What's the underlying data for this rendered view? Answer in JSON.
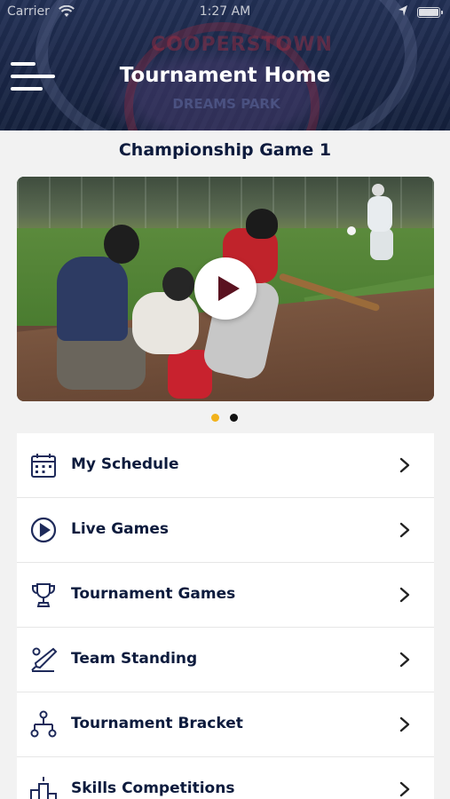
{
  "status_bar": {
    "carrier": "Carrier",
    "time": "1:27 AM",
    "icons": [
      "wifi-icon",
      "location-arrow-icon",
      "battery-icon"
    ]
  },
  "header": {
    "title": "Tournament Home",
    "background_logo_text": [
      "COOPERSTOWN",
      "DREAMS PARK"
    ],
    "menu_icon": "hamburger-menu-icon"
  },
  "featured": {
    "title": "Championship Game 1",
    "media": "baseball game video thumbnail",
    "play_icon": "play-icon",
    "pager": {
      "count": 2,
      "active_index": 0,
      "active_color": "#f2b21b",
      "inactive_color": "#111111"
    }
  },
  "menu": {
    "items": [
      {
        "label": "My Schedule",
        "icon": "calendar-icon"
      },
      {
        "label": "Live Games",
        "icon": "play-circle-icon"
      },
      {
        "label": "Tournament Games",
        "icon": "trophy-icon"
      },
      {
        "label": "Team Standing",
        "icon": "bat-and-ball-icon"
      },
      {
        "label": "Tournament Bracket",
        "icon": "bracket-icon"
      },
      {
        "label": "Skills Competitions",
        "icon": "podium-icon"
      }
    ],
    "chevron_icon": "chevron-right-icon"
  },
  "colors": {
    "header_bg": "#1a2748",
    "text_dark": "#0d1b3d",
    "accent_gold": "#f2b21b",
    "page_bg": "#f2f2f2"
  }
}
